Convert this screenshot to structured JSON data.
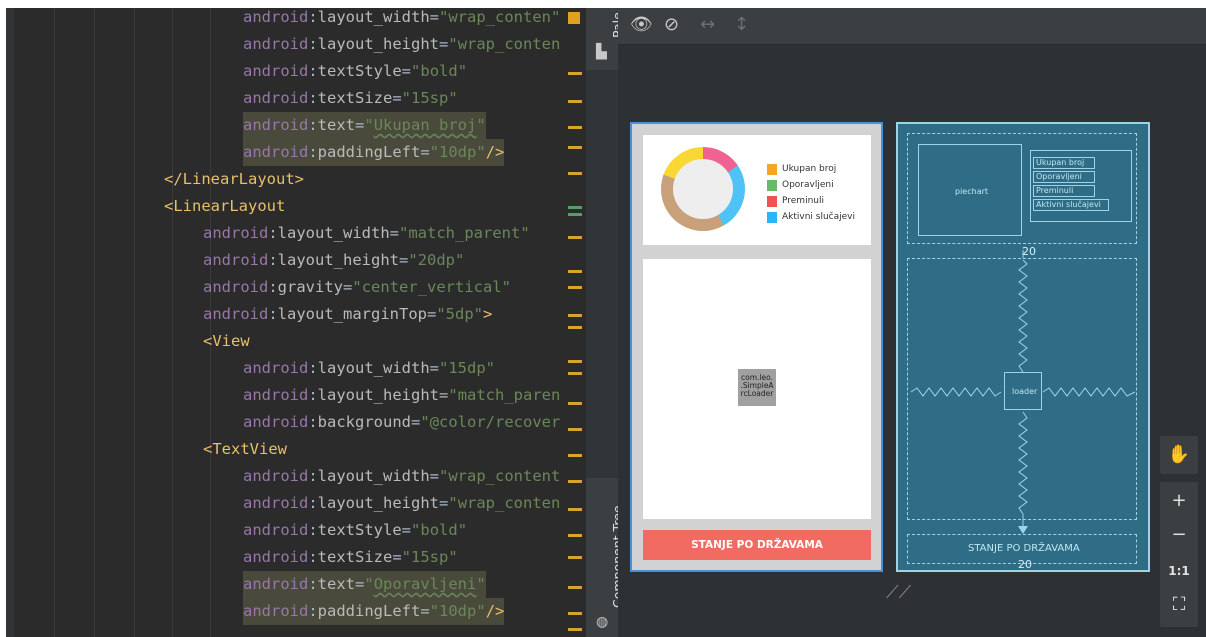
{
  "editor": {
    "lines": [
      {
        "ns": "android",
        "attr": "layout_width",
        "val": "wrap_conten",
        "close": ""
      },
      {
        "ns": "android",
        "attr": "layout_height",
        "val": "wrap_conten",
        "close": ""
      },
      {
        "ns": "android",
        "attr": "textStyle",
        "val": "bold",
        "close": ""
      },
      {
        "ns": "android",
        "attr": "textSize",
        "val": "15sp",
        "close": ""
      },
      {
        "ns": "android",
        "attr": "text",
        "val": "Ukupan broj",
        "close": ""
      },
      {
        "ns": "android",
        "attr": "paddingLeft",
        "val": "10dp",
        "close": "/>"
      },
      {
        "tag": "</LinearLayout>"
      },
      {
        "tag": "<LinearLayout"
      },
      {
        "ns": "android",
        "attr": "layout_width",
        "val": "match_parent",
        "close": ""
      },
      {
        "ns": "android",
        "attr": "layout_height",
        "val": "20dp",
        "close": ""
      },
      {
        "ns": "android",
        "attr": "gravity",
        "val": "center_vertical",
        "close": ""
      },
      {
        "ns": "android",
        "attr": "layout_marginTop",
        "val": "5dp",
        "close": ">"
      },
      {
        "tag": "<View"
      },
      {
        "ns": "android",
        "attr": "layout_width",
        "val": "15dp",
        "close": ""
      },
      {
        "ns": "android",
        "attr": "layout_height",
        "val": "match_paren",
        "close": ""
      },
      {
        "ns": "android",
        "attr": "background",
        "val": "@color/recover",
        "close": ""
      },
      {
        "tag": "<TextView"
      },
      {
        "ns": "android",
        "attr": "layout_width",
        "val": "wrap_content",
        "close": ""
      },
      {
        "ns": "android",
        "attr": "layout_height",
        "val": "wrap_conten",
        "close": ""
      },
      {
        "ns": "android",
        "attr": "textStyle",
        "val": "bold",
        "close": ""
      },
      {
        "ns": "android",
        "attr": "textSize",
        "val": "15sp",
        "close": ""
      },
      {
        "ns": "android",
        "attr": "text",
        "val": "Oporavljeni",
        "close": ""
      },
      {
        "ns": "android",
        "attr": "paddingLeft",
        "val": "10dp",
        "close": "/>"
      }
    ]
  },
  "side_tabs": {
    "palette": "Pale",
    "component_tree": "Component Tree"
  },
  "toolbar": {
    "icons": [
      "eye-icon",
      "magnet-off-icon",
      "horizontal-arrows-icon",
      "vertical-arrows-icon"
    ]
  },
  "preview": {
    "legend": [
      {
        "label": "Ukupan broj",
        "color": "#f5a623"
      },
      {
        "label": "Oporavljeni",
        "color": "#66bb6a"
      },
      {
        "label": "Preminuli",
        "color": "#ef5350"
      },
      {
        "label": "Aktivni slučajevi",
        "color": "#29b6f6"
      }
    ],
    "loader_text": "com.leo.\n.SimpleA\nrcLoader",
    "button_label": "STANJE PO DRŽAVAMA",
    "button_color": "#f26b62"
  },
  "blueprint": {
    "piechart_label": "piechart",
    "legend_labels": [
      "Ukupan broj",
      "Oporavljeni",
      "Preminuli",
      "Aktivni slučajevi"
    ],
    "margin_label_top": "20",
    "margin_label_bottom": "20",
    "loader_label": "loader",
    "button_label": "STANJE PO DRŽAVAMA"
  },
  "zoom_controls": {
    "pan": "✋",
    "zoom_in": "+",
    "zoom_out": "−",
    "actual_size": "1:1",
    "fit": "⛶"
  }
}
